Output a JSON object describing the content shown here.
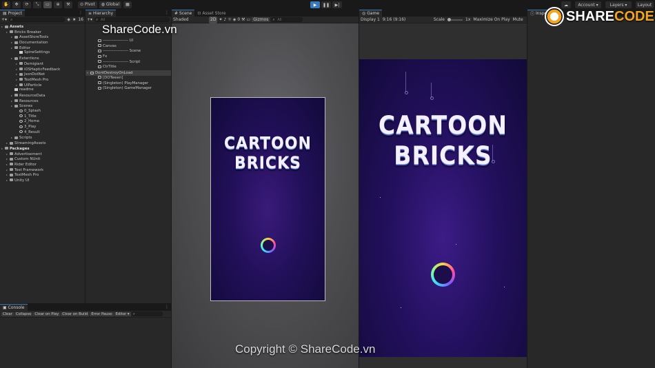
{
  "toolbar": {
    "tools": [
      "✋",
      "✥",
      "⟳",
      "⤡",
      "▭",
      "⊕",
      "⚒"
    ],
    "pivot": "Pivot",
    "global": "Global",
    "account": "Account",
    "layers": "Layers",
    "layout": "Layout"
  },
  "project": {
    "tab": "Project",
    "search_placeholder": "",
    "count": "16",
    "items": [
      {
        "label": "Assets",
        "depth": 0,
        "kind": "folder",
        "bold": true
      },
      {
        "label": "Bricks Breaker",
        "depth": 1,
        "kind": "folder"
      },
      {
        "label": "AssetStoreTools",
        "depth": 2,
        "kind": "folder"
      },
      {
        "label": "Documentation",
        "depth": 2,
        "kind": "folder"
      },
      {
        "label": "Editor",
        "depth": 2,
        "kind": "folder"
      },
      {
        "label": "SpineSettings",
        "depth": 3,
        "kind": "file"
      },
      {
        "label": "Extentions",
        "depth": 2,
        "kind": "folder"
      },
      {
        "label": "Demigiant",
        "depth": 3,
        "kind": "folder"
      },
      {
        "label": "iOSHapticFeedback",
        "depth": 3,
        "kind": "folder"
      },
      {
        "label": "JsonDotNet",
        "depth": 3,
        "kind": "folder"
      },
      {
        "label": "TextMesh Pro",
        "depth": 3,
        "kind": "folder"
      },
      {
        "label": "UIParticle",
        "depth": 3,
        "kind": "folder"
      },
      {
        "label": "readme",
        "depth": 2,
        "kind": "file"
      },
      {
        "label": "ResourceData",
        "depth": 2,
        "kind": "folder"
      },
      {
        "label": "Resources",
        "depth": 2,
        "kind": "folder"
      },
      {
        "label": "Scenes",
        "depth": 2,
        "kind": "folder"
      },
      {
        "label": "0_Splash",
        "depth": 3,
        "kind": "scene"
      },
      {
        "label": "1_Title",
        "depth": 3,
        "kind": "scene"
      },
      {
        "label": "2_Home",
        "depth": 3,
        "kind": "scene"
      },
      {
        "label": "3_Play",
        "depth": 3,
        "kind": "scene"
      },
      {
        "label": "4_Result",
        "depth": 3,
        "kind": "scene"
      },
      {
        "label": "Scripts",
        "depth": 2,
        "kind": "folder"
      },
      {
        "label": "StreamingAssets",
        "depth": 1,
        "kind": "folder"
      },
      {
        "label": "Packages",
        "depth": 0,
        "kind": "folder",
        "bold": true
      },
      {
        "label": "Advertisement",
        "depth": 1,
        "kind": "folder"
      },
      {
        "label": "Custom NUnit",
        "depth": 1,
        "kind": "folder"
      },
      {
        "label": "Rider Editor",
        "depth": 1,
        "kind": "folder"
      },
      {
        "label": "Test Framework",
        "depth": 1,
        "kind": "folder"
      },
      {
        "label": "TextMesh Pro",
        "depth": 1,
        "kind": "folder"
      },
      {
        "label": "Unity UI",
        "depth": 1,
        "kind": "folder"
      }
    ]
  },
  "hierarchy": {
    "tab": "Hierarchy",
    "search_placeholder": "All",
    "items": [
      {
        "label": "------------------- UI",
        "depth": 1
      },
      {
        "label": "Canvas",
        "depth": 1
      },
      {
        "label": "------------------- Scene",
        "depth": 1
      },
      {
        "label": "Fx",
        "depth": 1
      },
      {
        "label": "------------------- Script",
        "depth": 1
      },
      {
        "label": "CtrTitle",
        "depth": 1
      },
      {
        "label": "DontDestroyOnLoad",
        "depth": 0,
        "selected": true
      },
      {
        "label": "[DOTween]",
        "depth": 1
      },
      {
        "label": "(Singleton) PlayManager",
        "depth": 1
      },
      {
        "label": "(Singleton) GameManager",
        "depth": 1
      }
    ]
  },
  "scene": {
    "tabs": [
      "Scene",
      "Asset Store"
    ],
    "shading": "Shaded",
    "mode2d": "2D",
    "gizmos": "Gizmos",
    "search_placeholder": "All",
    "layer_count": "0"
  },
  "game": {
    "tab": "Game",
    "display": "Display 1",
    "aspect": "9:16 (9:16)",
    "scale_label": "Scale",
    "scale_value": "1x",
    "maximize": "Maximize On Play",
    "mute": "Mute"
  },
  "inspector": {
    "tab": "Inspe"
  },
  "console": {
    "tab": "Console",
    "buttons": [
      "Clear",
      "Collapse",
      "Clear on Play",
      "Clear on Build",
      "Error Pause",
      "Editor ▾"
    ]
  },
  "game_logo": {
    "line1": "CARTOON",
    "line2": "BRICKS"
  },
  "watermarks": {
    "top": "ShareCode.vn",
    "bottom": "Copyright © ShareCode.vn",
    "brand_a": "SHARE",
    "brand_b": "CODE.vn"
  }
}
